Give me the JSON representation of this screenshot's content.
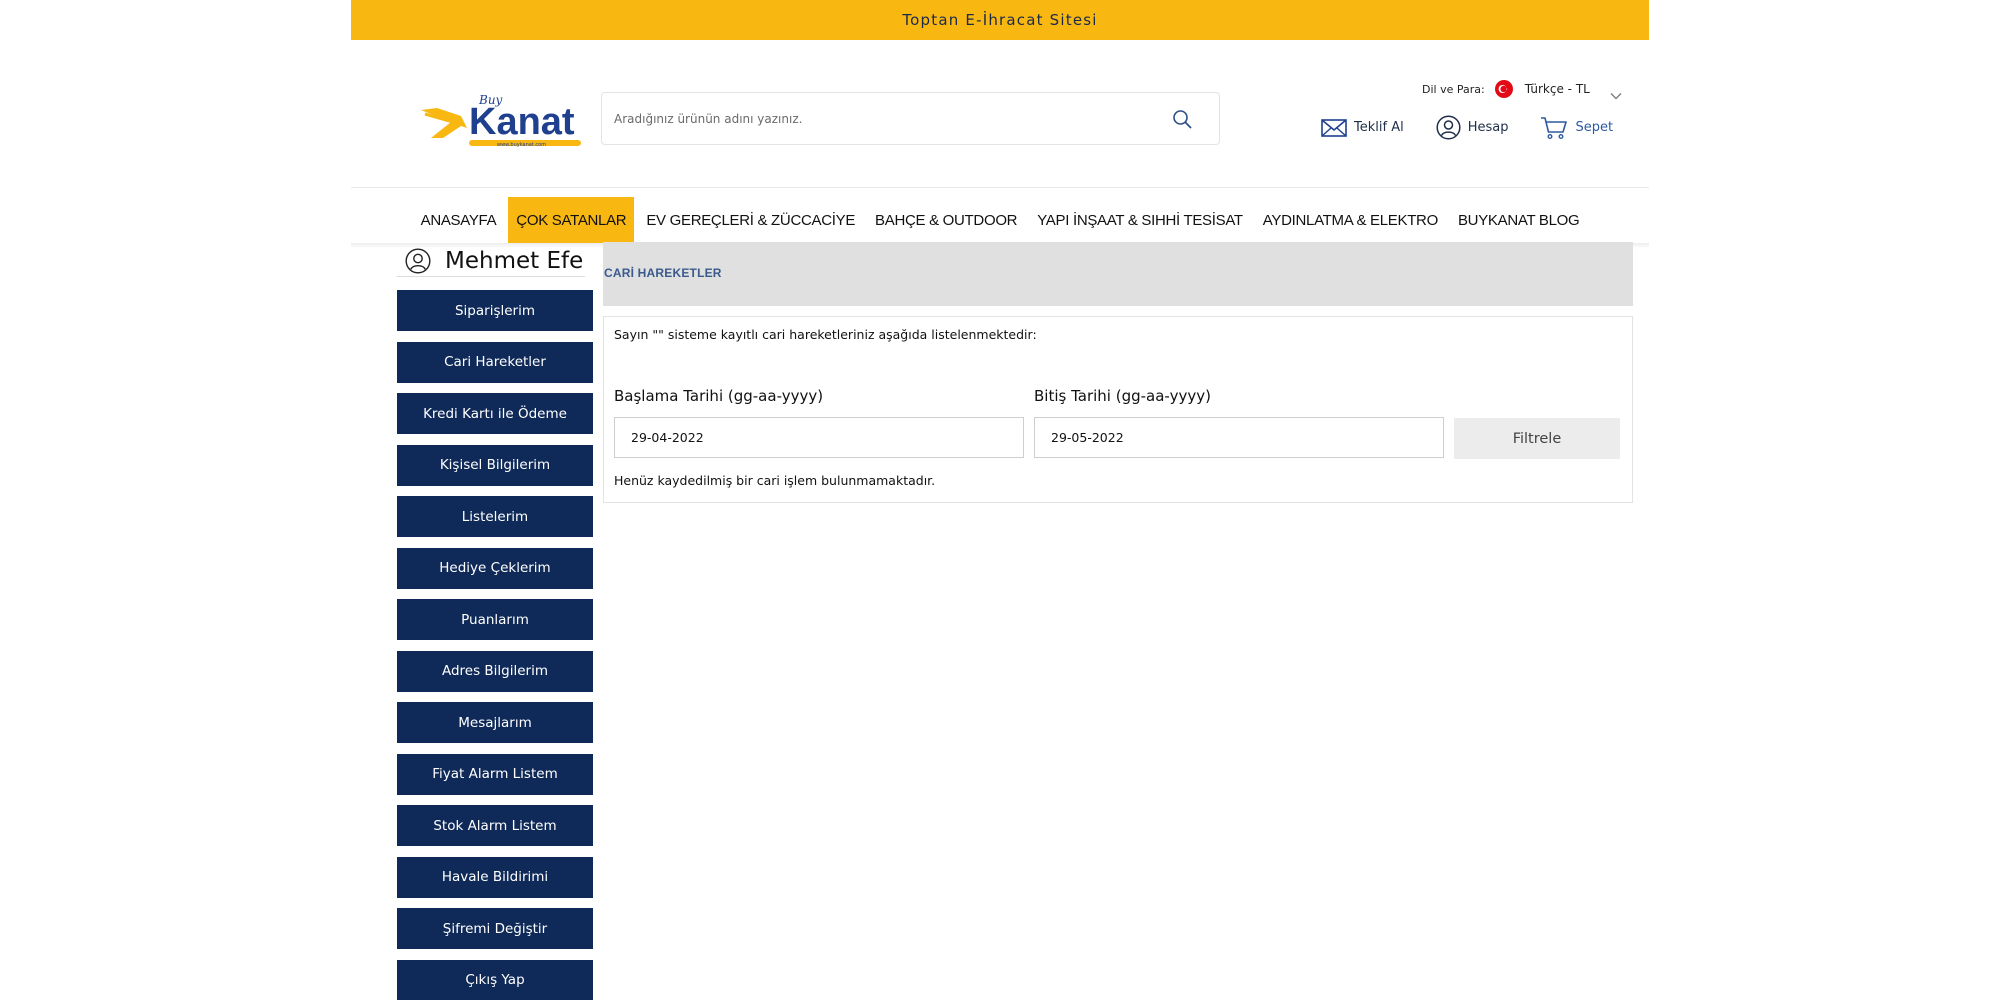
{
  "banner": {
    "text": "Toptan E-İhracat Sitesi"
  },
  "logo": {
    "brand": "Kanat",
    "tagline": "Buy",
    "subtext": "www.buykanat.com"
  },
  "search": {
    "placeholder": "Aradığınız ürünün adını yazınız."
  },
  "language": {
    "label": "Dil ve Para:",
    "value": "Türkçe - TL"
  },
  "actions": {
    "quote": "Teklif Al",
    "account": "Hesap",
    "cart": "Sepet"
  },
  "nav": {
    "items": [
      "ANASAYFA",
      "ÇOK SATANLAR",
      "EV GEREÇLERİ & ZÜCCACİYE",
      "BAHÇE & OUTDOOR",
      "YAPI İNŞAAT & SIHHİ TESİSAT",
      "AYDINLATMA & ELEKTRO",
      "BUYKANAT BLOG"
    ],
    "active": "ÇOK SATANLAR"
  },
  "user": {
    "name": "Mehmet Efe"
  },
  "sidebar": {
    "items": [
      "Siparişlerim",
      "Cari Hareketler",
      "Kredi Kartı ile Ödeme",
      "Kişisel Bilgilerim",
      "Listelerim",
      "Hediye Çeklerim",
      "Puanlarım",
      "Adres Bilgilerim",
      "Mesajlarım",
      "Fiyat Alarm Listem",
      "Stok Alarm Listem",
      "Havale Bildirimi",
      "Şifremi Değiştir",
      "Çıkış Yap"
    ]
  },
  "content": {
    "title": "CARİ HAREKETLER",
    "intro": "Sayın \"\" sisteme kayıtlı cari hareketleriniz aşağıda listelenmektedir:",
    "start_label": "Başlama Tarihi (gg-aa-yyyy)",
    "start_value": "29-04-2022",
    "end_label": "Bitiş Tarihi (gg-aa-yyyy)",
    "end_value": "29-05-2022",
    "filter_button": "Filtrele",
    "empty_message": "Henüz kaydedilmiş bir cari işlem bulunmamaktadır."
  },
  "colors": {
    "accent": "#f9b712",
    "navy": "#0f2a58",
    "panel_gray": "#e0e0e0",
    "flag_red": "#e30a17"
  },
  "icons": [
    "search-icon",
    "envelope-icon",
    "user-icon",
    "cart-icon",
    "chevron-down-icon",
    "turkey-flag-icon"
  ]
}
